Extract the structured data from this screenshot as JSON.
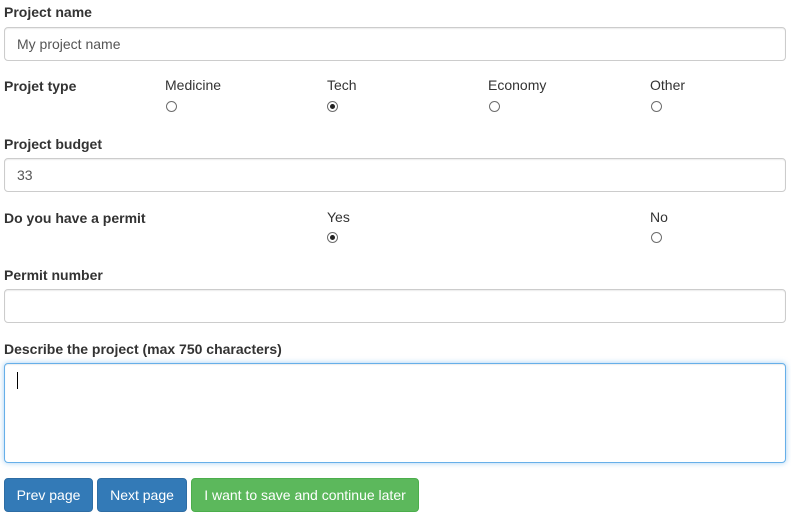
{
  "project_name": {
    "label": "Project name",
    "value": "My project name"
  },
  "project_type": {
    "label": "Projet type",
    "options": [
      {
        "label": "Medicine",
        "checked": false
      },
      {
        "label": "Tech",
        "checked": true
      },
      {
        "label": "Economy",
        "checked": false
      },
      {
        "label": "Other",
        "checked": false
      }
    ]
  },
  "project_budget": {
    "label": "Project budget",
    "value": "33"
  },
  "permit": {
    "label": "Do you have a permit",
    "options": [
      {
        "label": "Yes",
        "checked": true
      },
      {
        "label": "No",
        "checked": false
      }
    ]
  },
  "permit_number": {
    "label": "Permit number",
    "value": ""
  },
  "description": {
    "label": "Describe the project (max 750 characters)",
    "value": ""
  },
  "buttons": {
    "prev": "Prev page",
    "next": "Next page",
    "save": "I want to save and continue later"
  },
  "colors": {
    "primary": "#337ab7",
    "success": "#5cb85c",
    "focus_border": "#66afe9"
  }
}
